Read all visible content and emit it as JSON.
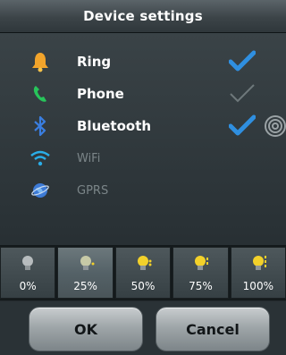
{
  "title": "Device settings",
  "toggles": [
    {
      "label": "Ring",
      "icon": "bell-icon",
      "checked": true,
      "enabled": true
    },
    {
      "label": "Phone",
      "icon": "phone-icon",
      "checked": false,
      "enabled": true
    },
    {
      "label": "Bluetooth",
      "icon": "bluetooth-icon",
      "checked": true,
      "enabled": true
    },
    {
      "label": "WiFi",
      "icon": "wifi-icon",
      "checked": false,
      "enabled": false
    },
    {
      "label": "GPRS",
      "icon": "gprs-globe-icon",
      "checked": false,
      "enabled": false
    }
  ],
  "brightness": {
    "options": [
      "0%",
      "25%",
      "50%",
      "75%",
      "100%"
    ],
    "selected": "25%"
  },
  "buttons": {
    "ok": "OK",
    "cancel": "Cancel"
  },
  "colors": {
    "accent_check": "#2f8fe0",
    "bulb": "#f3d12a",
    "disabled_text": "#7b8588"
  }
}
